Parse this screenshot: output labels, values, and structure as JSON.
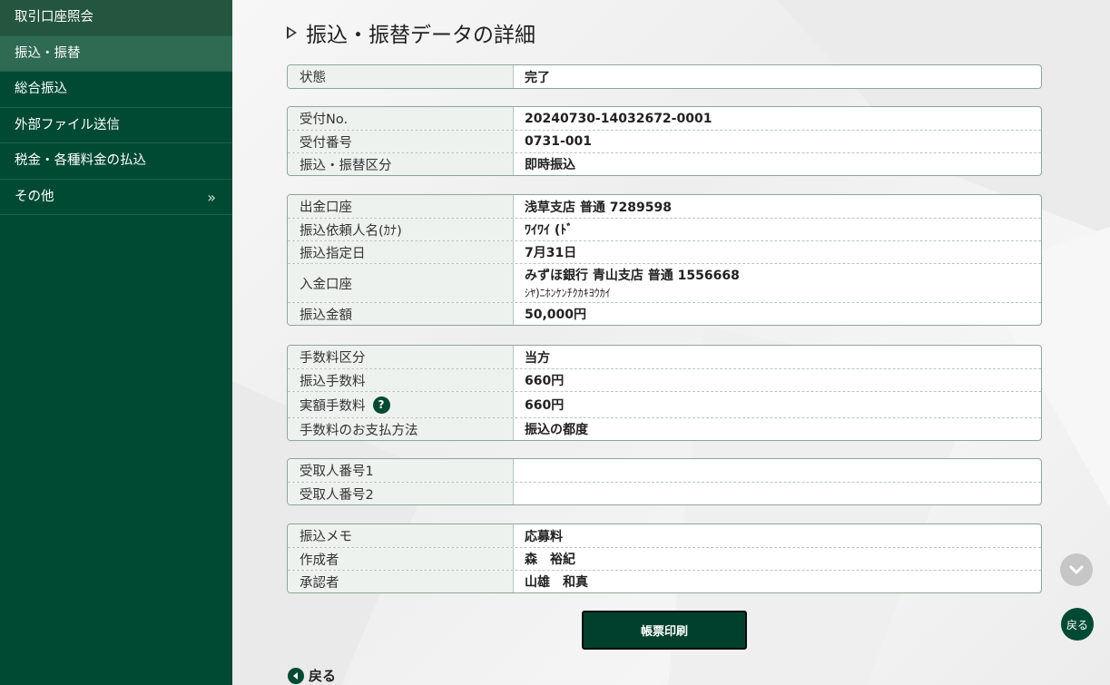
{
  "sidebar": {
    "items": [
      {
        "label": "取引口座照会"
      },
      {
        "label": "振込・振替"
      },
      {
        "label": "総合振込"
      },
      {
        "label": "外部ファイル送信"
      },
      {
        "label": "税金・各種料金の払込"
      },
      {
        "label": "その他",
        "chevron": "»"
      }
    ]
  },
  "page": {
    "title": "振込・振替データの詳細"
  },
  "status_table": [
    {
      "label": "状態",
      "value": "完了"
    }
  ],
  "receipt_table": [
    {
      "label": "受付No.",
      "value": "20240730-14032672-0001"
    },
    {
      "label": "受付番号",
      "value": "0731-001"
    },
    {
      "label": "振込・振替区分",
      "value": "即時振込"
    }
  ],
  "transfer_table": {
    "from_account": {
      "label": "出金口座",
      "value": "浅草支店 普通 7289598"
    },
    "requester": {
      "label": "振込依頼人名(ｶﾅ)",
      "value": "ﾜｲﾜｲ (ﾄﾞ"
    },
    "date": {
      "label": "振込指定日",
      "value": "7月31日"
    },
    "to_account": {
      "label": "入金口座",
      "value": "みずほ銀行 青山支店 普通 1556668",
      "sub": "ｼﾔ)ﾆﾎﾝｹﾝﾁｸｶｷﾖｳｶｲ"
    },
    "amount": {
      "label": "振込金額",
      "value": "50,000円"
    }
  },
  "fee_table": {
    "fee_type": {
      "label": "手数料区分",
      "value": "当方"
    },
    "fee": {
      "label": "振込手数料",
      "value": "660円"
    },
    "actual_fee": {
      "label": "実額手数料",
      "value": "660円",
      "help": "?"
    },
    "payment": {
      "label": "手数料のお支払方法",
      "value": "振込の都度"
    }
  },
  "recipient_table": [
    {
      "label": "受取人番号1",
      "value": ""
    },
    {
      "label": "受取人番号2",
      "value": ""
    }
  ],
  "memo_table": [
    {
      "label": "振込メモ",
      "value": "応募料"
    },
    {
      "label": "作成者",
      "value": "森　裕紀"
    },
    {
      "label": "承認者",
      "value": "山雄　和真"
    }
  ],
  "buttons": {
    "print": "帳票印刷",
    "back": "戻る",
    "float_back": "戻る"
  },
  "colors": {
    "brand": "#004a33",
    "label_bg": "#edf2ef"
  }
}
